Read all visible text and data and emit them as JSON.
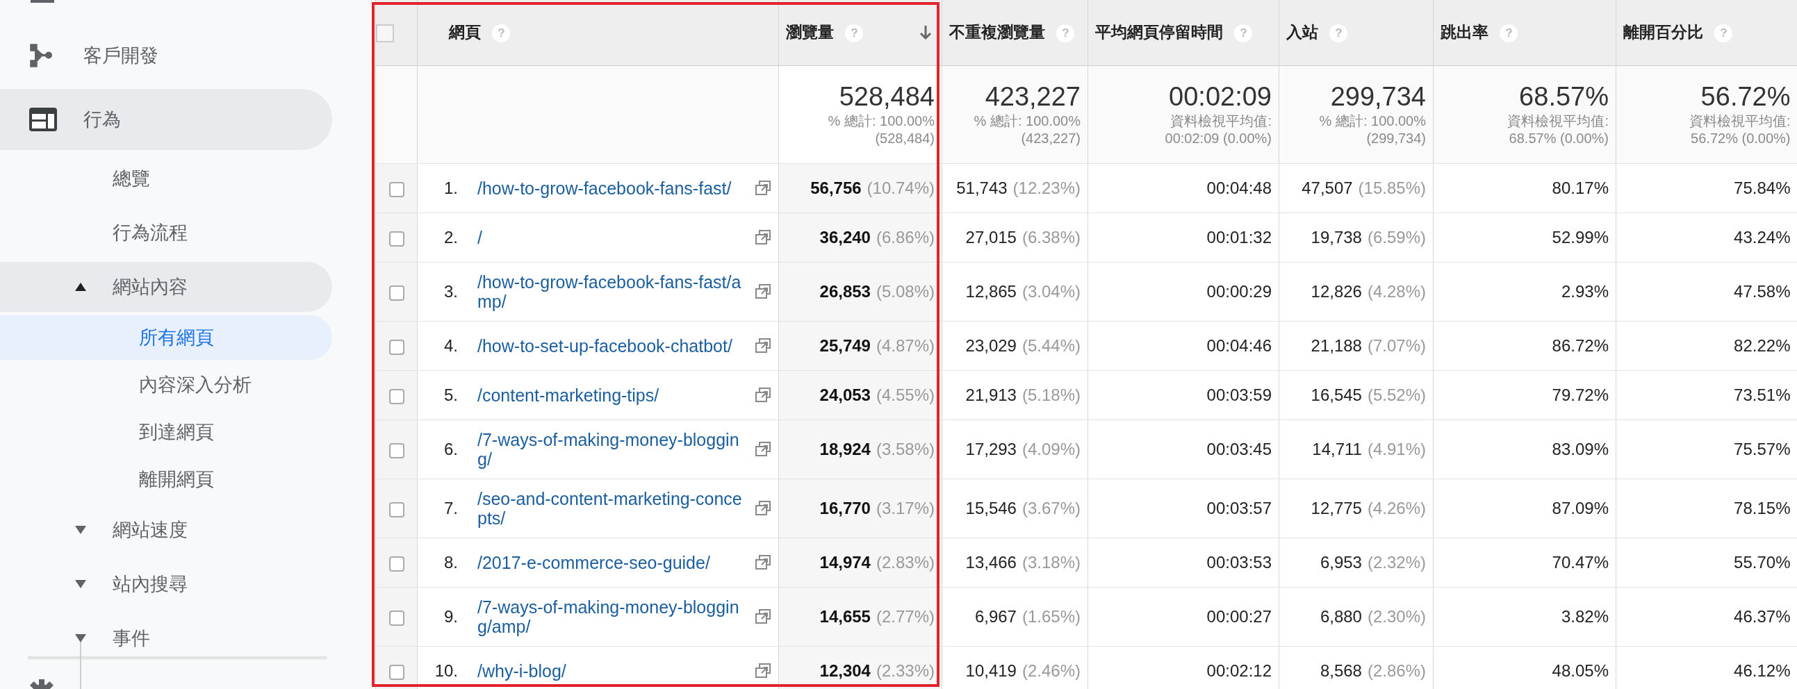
{
  "sidebar": {
    "items": [
      {
        "label": "客戶開發",
        "kind": "branch",
        "selected": false
      },
      {
        "label": "行為",
        "kind": "panel",
        "selected": false,
        "children": [
          {
            "label": "總覽",
            "selected": false
          },
          {
            "label": "行為流程",
            "selected": false
          },
          {
            "label": "網站內容",
            "selected": false,
            "expanded": true,
            "children": [
              {
                "label": "所有網頁",
                "selected": true
              },
              {
                "label": "內容深入分析",
                "selected": false
              },
              {
                "label": "到達網頁",
                "selected": false
              },
              {
                "label": "離開網頁",
                "selected": false
              }
            ]
          },
          {
            "label": "網站速度",
            "selected": false,
            "expanded": false
          },
          {
            "label": "站內搜尋",
            "selected": false,
            "expanded": false
          },
          {
            "label": "事件",
            "selected": false,
            "expanded": false
          }
        ]
      }
    ]
  },
  "table": {
    "checked": false,
    "highlight_frame": true,
    "page_column": {
      "label": "網頁",
      "help": "?"
    },
    "columns": [
      {
        "label": "瀏覽量",
        "help": "?",
        "sorted": true
      },
      {
        "label": "不重複瀏覽量",
        "help": "?",
        "sorted": false
      },
      {
        "label": "平均網頁停留時間",
        "help": "?",
        "sorted": false
      },
      {
        "label": "入站",
        "help": "?",
        "sorted": false
      },
      {
        "label": "跳出率",
        "help": "?",
        "sorted": false
      },
      {
        "label": "離開百分比",
        "help": "?",
        "sorted": false
      }
    ],
    "totals": [
      {
        "value": "528,484",
        "lines": [
          "% 總計: 100.00%",
          "(528,484)"
        ]
      },
      {
        "value": "423,227",
        "lines": [
          "% 總計: 100.00%",
          "(423,227)"
        ]
      },
      {
        "value": "00:02:09",
        "lines": [
          "資料檢視平均值:",
          "00:02:09 (0.00%)"
        ]
      },
      {
        "value": "299,734",
        "lines": [
          "% 總計: 100.00%",
          "(299,734)"
        ]
      },
      {
        "value": "68.57%",
        "lines": [
          "資料檢視平均值:",
          "68.57% (0.00%)"
        ]
      },
      {
        "value": "56.72%",
        "lines": [
          "資料檢視平均值:",
          "56.72% (0.00%)"
        ]
      }
    ],
    "rows": [
      {
        "rank": "1.",
        "page": "/how-to-grow-facebook-fans-fast/",
        "checked": false,
        "cells": [
          {
            "value": "56,756",
            "share": "(10.74%)"
          },
          {
            "value": "51,743",
            "share": "(12.23%)"
          },
          {
            "value": "00:04:48"
          },
          {
            "value": "47,507",
            "share": "(15.85%)"
          },
          {
            "value": "80.17%"
          },
          {
            "value": "75.84%"
          }
        ]
      },
      {
        "rank": "2.",
        "page": "/",
        "checked": false,
        "cells": [
          {
            "value": "36,240",
            "share": "(6.86%)"
          },
          {
            "value": "27,015",
            "share": "(6.38%)"
          },
          {
            "value": "00:01:32"
          },
          {
            "value": "19,738",
            "share": "(6.59%)"
          },
          {
            "value": "52.99%"
          },
          {
            "value": "43.24%"
          }
        ]
      },
      {
        "rank": "3.",
        "page": "/how-to-grow-facebook-fans-fast/amp/",
        "checked": false,
        "cells": [
          {
            "value": "26,853",
            "share": "(5.08%)"
          },
          {
            "value": "12,865",
            "share": "(3.04%)"
          },
          {
            "value": "00:00:29"
          },
          {
            "value": "12,826",
            "share": "(4.28%)"
          },
          {
            "value": "2.93%"
          },
          {
            "value": "47.58%"
          }
        ]
      },
      {
        "rank": "4.",
        "page": "/how-to-set-up-facebook-chatbot/",
        "checked": false,
        "cells": [
          {
            "value": "25,749",
            "share": "(4.87%)"
          },
          {
            "value": "23,029",
            "share": "(5.44%)"
          },
          {
            "value": "00:04:46"
          },
          {
            "value": "21,188",
            "share": "(7.07%)"
          },
          {
            "value": "86.72%"
          },
          {
            "value": "82.22%"
          }
        ]
      },
      {
        "rank": "5.",
        "page": "/content-marketing-tips/",
        "checked": false,
        "cells": [
          {
            "value": "24,053",
            "share": "(4.55%)"
          },
          {
            "value": "21,913",
            "share": "(5.18%)"
          },
          {
            "value": "00:03:59"
          },
          {
            "value": "16,545",
            "share": "(5.52%)"
          },
          {
            "value": "79.72%"
          },
          {
            "value": "73.51%"
          }
        ]
      },
      {
        "rank": "6.",
        "page": "/7-ways-of-making-money-blogging/",
        "checked": false,
        "cells": [
          {
            "value": "18,924",
            "share": "(3.58%)"
          },
          {
            "value": "17,293",
            "share": "(4.09%)"
          },
          {
            "value": "00:03:45"
          },
          {
            "value": "14,711",
            "share": "(4.91%)"
          },
          {
            "value": "83.09%"
          },
          {
            "value": "75.57%"
          }
        ]
      },
      {
        "rank": "7.",
        "page": "/seo-and-content-marketing-concepts/",
        "checked": false,
        "cells": [
          {
            "value": "16,770",
            "share": "(3.17%)"
          },
          {
            "value": "15,546",
            "share": "(3.67%)"
          },
          {
            "value": "00:03:57"
          },
          {
            "value": "12,775",
            "share": "(4.26%)"
          },
          {
            "value": "87.09%"
          },
          {
            "value": "78.15%"
          }
        ]
      },
      {
        "rank": "8.",
        "page": "/2017-e-commerce-seo-guide/",
        "checked": false,
        "cells": [
          {
            "value": "14,974",
            "share": "(2.83%)"
          },
          {
            "value": "13,466",
            "share": "(3.18%)"
          },
          {
            "value": "00:03:53"
          },
          {
            "value": "6,953",
            "share": "(2.32%)"
          },
          {
            "value": "70.47%"
          },
          {
            "value": "55.70%"
          }
        ]
      },
      {
        "rank": "9.",
        "page": "/7-ways-of-making-money-blogging/amp/",
        "checked": false,
        "cells": [
          {
            "value": "14,655",
            "share": "(2.77%)"
          },
          {
            "value": "6,967",
            "share": "(1.65%)"
          },
          {
            "value": "00:00:27"
          },
          {
            "value": "6,880",
            "share": "(2.30%)"
          },
          {
            "value": "3.82%"
          },
          {
            "value": "46.37%"
          }
        ]
      },
      {
        "rank": "10.",
        "page": "/why-i-blog/",
        "checked": false,
        "cells": [
          {
            "value": "12,304",
            "share": "(2.33%)"
          },
          {
            "value": "10,419",
            "share": "(2.46%)"
          },
          {
            "value": "00:02:12"
          },
          {
            "value": "8,568",
            "share": "(2.86%)"
          },
          {
            "value": "48.05%"
          },
          {
            "value": "46.12%"
          }
        ]
      }
    ]
  }
}
